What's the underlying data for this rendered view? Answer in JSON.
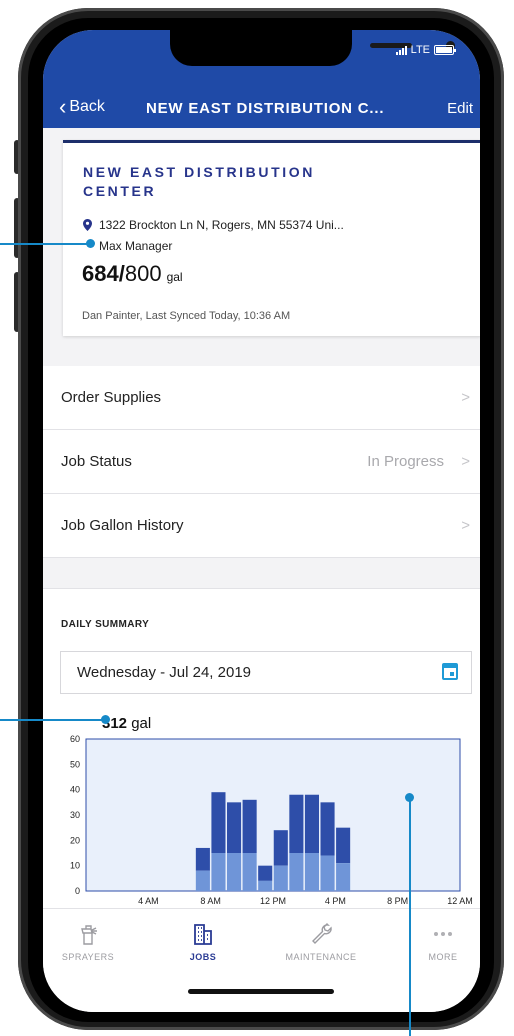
{
  "navbar": {
    "back_label": "Back",
    "title": "NEW EAST DISTRIBUTION C...",
    "edit_label": "Edit"
  },
  "status": {
    "network": "LTE"
  },
  "card": {
    "title": "NEW EAST DISTRIBUTION CENTER",
    "address": "1322 Brockton Ln N, Rogers, MN 55374 Uni...",
    "manager": "Max Manager",
    "gallons_current": "684",
    "gallons_sep": "/",
    "gallons_max": "800",
    "gallons_unit": "gal",
    "sync": "Dan Painter, Last Synced Today, 10:36 AM"
  },
  "menu": {
    "items": [
      {
        "label": "Order Supplies",
        "value": ""
      },
      {
        "label": "Job Status",
        "value": "In Progress"
      },
      {
        "label": "Job Gallon History",
        "value": ""
      }
    ]
  },
  "summary": {
    "title": "DAILY SUMMARY",
    "date": "Wednesday - Jul 24, 2019",
    "total_value": "312",
    "total_unit": "gal"
  },
  "chart_data": {
    "type": "bar",
    "stacked": true,
    "ylim": [
      0,
      60
    ],
    "yticks": [
      "0",
      "10",
      "20",
      "30",
      "40",
      "50",
      "60"
    ],
    "xticks": [
      "4 AM",
      "8 AM",
      "12 PM",
      "4 PM",
      "8 PM",
      "12 AM"
    ],
    "x_hours": [
      7,
      8,
      9,
      10,
      11,
      12,
      13,
      14,
      15,
      16
    ],
    "series": [
      {
        "values": [
          8,
          15,
          15,
          15,
          4,
          10,
          15,
          15,
          14,
          11
        ]
      },
      {
        "values": [
          9,
          24,
          20,
          21,
          6,
          14,
          23,
          23,
          21,
          14
        ]
      }
    ],
    "colors": {
      "lower": "#6f95d8",
      "upper": "#2e4ea9",
      "plot_bg": "#e9f0fb",
      "frame": "#2e4ea9"
    }
  },
  "tabbar": {
    "tabs": [
      {
        "label": "SPRAYERS",
        "icon": "sprayer-icon"
      },
      {
        "label": "JOBS",
        "icon": "building-icon"
      },
      {
        "label": "MAINTENANCE",
        "icon": "wrench-icon"
      },
      {
        "label": "MORE",
        "icon": "more-dots-icon"
      }
    ]
  },
  "colors": {
    "brand": "#1f4aa7",
    "accent": "#1689c8",
    "title": "#27348b"
  }
}
